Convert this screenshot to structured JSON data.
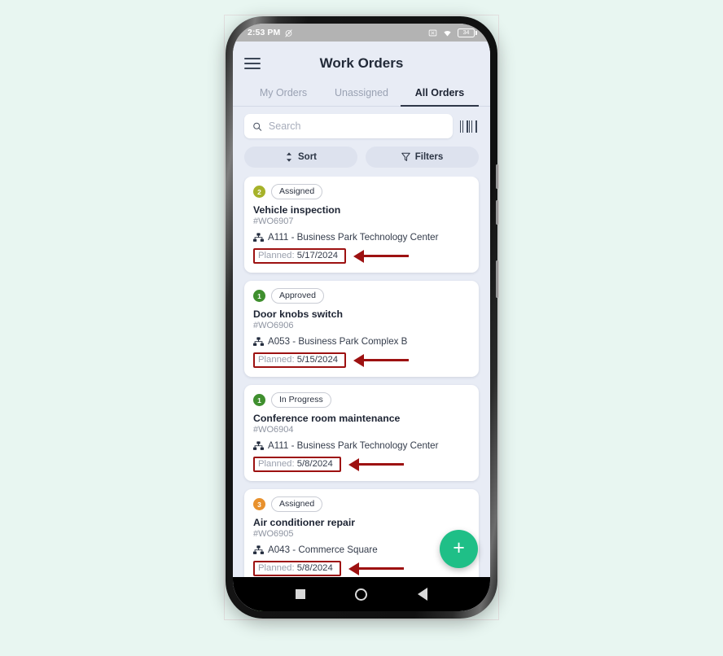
{
  "status_bar": {
    "time": "2:53 PM",
    "alarm_off_icon": "alarm-off-icon",
    "cast_icon": "cast-off-icon",
    "wifi_icon": "wifi-icon",
    "battery_level": "34"
  },
  "header": {
    "menu_icon": "hamburger-menu-icon",
    "title": "Work Orders"
  },
  "tabs": [
    {
      "label": "My Orders",
      "active": false
    },
    {
      "label": "Unassigned",
      "active": false
    },
    {
      "label": "All Orders",
      "active": true
    }
  ],
  "search": {
    "icon": "search-icon",
    "placeholder": "Search",
    "value": "",
    "barcode_icon": "barcode-scan-icon"
  },
  "actions": {
    "sort_label": "Sort",
    "sort_icon": "sort-updown-icon",
    "filters_label": "Filters",
    "filters_icon": "funnel-filter-icon"
  },
  "colors": {
    "background": "#e8f6f1",
    "app_background": "#e8ecf5",
    "accent_fab": "#1fbf87",
    "annotation_red": "#9d1111",
    "priority_2": "#a6b22a",
    "priority_1": "#3f8f2e",
    "priority_3": "#e8912d",
    "tab_active": "#2e3748"
  },
  "work_orders": [
    {
      "priority": "2",
      "priority_color": "#a6b22a",
      "status": "Assigned",
      "title": "Vehicle inspection",
      "number": "#WO6907",
      "location_icon": "sitemap-icon",
      "location": "A111 - Business Park Technology Center",
      "planned_label": "Planned:",
      "planned_date": "5/17/2024",
      "annotated": true
    },
    {
      "priority": "1",
      "priority_color": "#3f8f2e",
      "status": "Approved",
      "title": "Door knobs switch",
      "number": "#WO6906",
      "location_icon": "sitemap-icon",
      "location": "A053 - Business Park Complex B",
      "planned_label": "Planned:",
      "planned_date": "5/15/2024",
      "annotated": true
    },
    {
      "priority": "1",
      "priority_color": "#3f8f2e",
      "status": "In Progress",
      "title": "Conference room maintenance",
      "number": "#WO6904",
      "location_icon": "sitemap-icon",
      "location": "A111 - Business Park Technology Center",
      "planned_label": "Planned:",
      "planned_date": "5/8/2024",
      "annotated": true
    },
    {
      "priority": "3",
      "priority_color": "#e8912d",
      "status": "Assigned",
      "title": "Air conditioner repair",
      "number": "#WO6905",
      "location_icon": "sitemap-icon",
      "location": "A043 - Commerce Square",
      "planned_label": "Planned:",
      "planned_date": "5/8/2024",
      "annotated": true
    }
  ],
  "partial_card": {
    "priority": "",
    "priority_color": "#3f8f2e",
    "status": ""
  },
  "fab": {
    "icon": "plus-icon",
    "label": "+"
  },
  "nav_bar": {
    "recents_icon": "square-recents-icon",
    "home_icon": "circle-home-icon",
    "back_icon": "triangle-back-icon"
  }
}
